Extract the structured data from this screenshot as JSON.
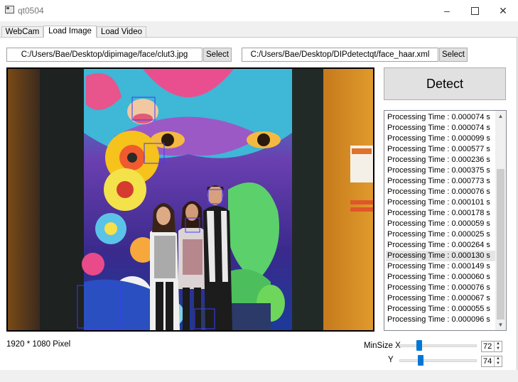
{
  "window": {
    "title": "qt0504"
  },
  "tabs": [
    "WebCam",
    "Load Image",
    "Load Video"
  ],
  "image_path": {
    "value": "C:/Users/Bae/Desktop/dipimage/face/clut3.jpg",
    "button": "Select"
  },
  "cascade_path": {
    "value": "C:/Users/Bae/Desktop/DIPdetectqt/face_haar.xml",
    "button": "Select"
  },
  "detect_button": "Detect",
  "log": {
    "items": [
      "Processing Time : 0.000074 s",
      "Processing Time : 0.000074 s",
      "Processing Time : 0.000099 s",
      "Processing Time : 0.000577 s",
      "Processing Time : 0.000236 s",
      "Processing Time : 0.000375 s",
      "Processing Time : 0.000773 s",
      "Processing Time : 0.000076 s",
      "Processing Time : 0.000101 s",
      "Processing Time : 0.000178 s",
      "Processing Time : 0.000059 s",
      "Processing Time : 0.000025 s",
      "Processing Time : 0.000264 s",
      "Processing Time : 0.000130 s",
      "Processing Time : 0.000149 s",
      "Processing Time : 0.000060 s",
      "Processing Time : 0.000076 s",
      "Processing Time : 0.000067 s",
      "Processing Time : 0.000055 s",
      "Processing Time : 0.000096 s"
    ],
    "selected_index": 13
  },
  "image_info": "1920 * 1080 Pixel",
  "minsize": {
    "x_label": "MinSize X",
    "y_label": "Y",
    "x_value": "72",
    "y_value": "74",
    "x_slider_fraction": 0.24,
    "y_slider_fraction": 0.25
  },
  "colors": {
    "accent": "#0078d7",
    "detection_box": "#3b3bff"
  }
}
